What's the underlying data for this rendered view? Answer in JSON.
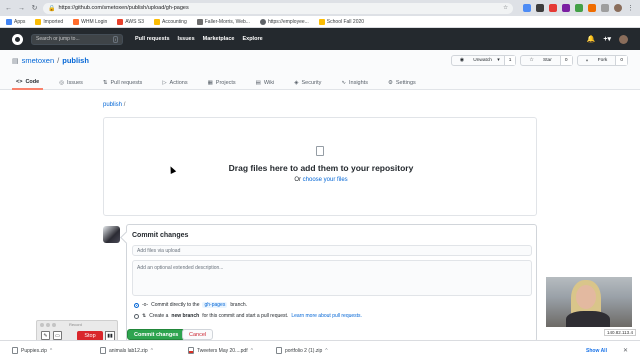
{
  "browser": {
    "url": "https://github.com/smetoxen/publish/upload/gh-pages",
    "bookmarks": [
      "Apps",
      "Imported",
      "WHM Login",
      "AWS S3",
      "Accounting",
      "Faller-Morris, Web...",
      "https://employee...",
      "School Fall 2020"
    ]
  },
  "gh_header": {
    "search_placeholder": "Search or jump to...",
    "search_key": "/",
    "nav": [
      "Pull requests",
      "Issues",
      "Marketplace",
      "Explore"
    ]
  },
  "repo": {
    "owner": "smetoxen",
    "separator": "/",
    "name": "publish",
    "watch_label": "Unwatch",
    "watch_count": "1",
    "star_label": "Star",
    "star_count": "0",
    "fork_label": "Fork",
    "fork_count": "0",
    "tabs": [
      {
        "icon": "<>",
        "label": "Code"
      },
      {
        "icon": "◎",
        "label": "Issues"
      },
      {
        "icon": "⇅",
        "label": "Pull requests"
      },
      {
        "icon": "▷",
        "label": "Actions"
      },
      {
        "icon": "▦",
        "label": "Projects"
      },
      {
        "icon": "▤",
        "label": "Wiki"
      },
      {
        "icon": "◈",
        "label": "Security"
      },
      {
        "icon": "∿",
        "label": "Insights"
      },
      {
        "icon": "⚙",
        "label": "Settings"
      }
    ]
  },
  "breadcrumb": {
    "repo": "publish",
    "sep": "/"
  },
  "dropzone": {
    "title": "Drag files here to add them to your repository",
    "or": "Or",
    "choose": "choose your files"
  },
  "commit": {
    "title": "Commit changes",
    "summary_placeholder": "Add files via upload",
    "description_placeholder": "Add an optional extended description...",
    "option_direct_pre": "Commit directly to the",
    "branch": "gh-pages",
    "option_direct_post": "branch.",
    "option_new_pre": "Create a",
    "option_new_bold": "new branch",
    "option_new_post": "for this commit and start a pull request.",
    "option_new_link": "Learn more about pull requests.",
    "commit_button": "Commit changes",
    "cancel_button": "Cancel"
  },
  "recorder": {
    "label": "Record",
    "stop": "Stop"
  },
  "webcam": {
    "ip": "140.82.113.4"
  },
  "downloads": {
    "items": [
      "Puppies.zip",
      "animals lab12.zip",
      "Tweeters May 20....pdf",
      "portfolio 2 (1).zip"
    ],
    "show_all": "Show All",
    "close": "✕"
  }
}
